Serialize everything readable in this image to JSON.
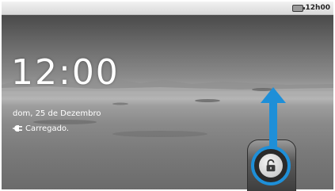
{
  "status_bar": {
    "time": "12h00",
    "battery_icon": "battery-icon"
  },
  "lock_screen": {
    "clock": "12:00",
    "date": "dom, 25 de Dezembro",
    "charging_status": "Carregado.",
    "charging_icon": "plug-icon",
    "unlock_icon": "unlock-icon"
  },
  "colors": {
    "accent": "#1e8fd8",
    "text": "#ffffff"
  }
}
